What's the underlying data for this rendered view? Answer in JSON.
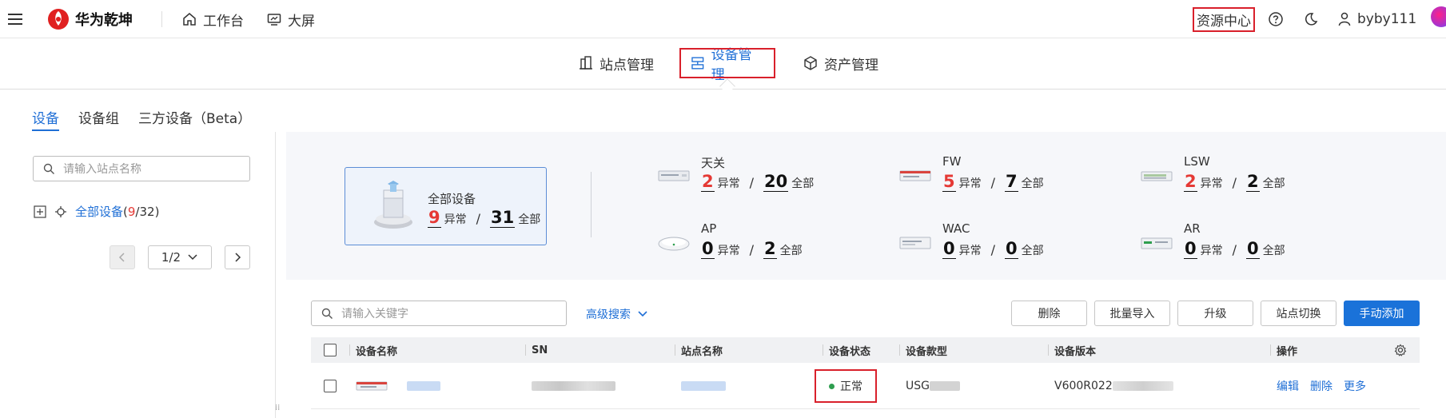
{
  "topbar": {
    "logo_text": "华为乾坤",
    "nav": [
      "工作台",
      "大屏"
    ],
    "resource_center": "资源中心",
    "username": "byby111"
  },
  "secnav": {
    "tabs": [
      "站点管理",
      "设备管理",
      "资产管理"
    ],
    "active": "设备管理"
  },
  "subtabs": [
    "设备",
    "设备组",
    "三方设备（Beta）"
  ],
  "leftpane": {
    "site_search_placeholder": "请输入站点名称",
    "tree_label": "全部设备",
    "tree_abnormal": "9",
    "tree_total": "/32",
    "page": "1/2"
  },
  "stats": {
    "all": {
      "title": "全部设备",
      "abnormal": "9",
      "total": "31"
    },
    "abnormal_label": "异常",
    "total_label": "全部",
    "slash": "/",
    "items": [
      {
        "name": "天关",
        "abnormal": "2",
        "total": "20",
        "icon": "gateway-device-icon"
      },
      {
        "name": "FW",
        "abnormal": "5",
        "total": "7",
        "icon": "firewall-device-icon"
      },
      {
        "name": "LSW",
        "abnormal": "2",
        "total": "2",
        "icon": "switch-device-icon"
      },
      {
        "name": "AP",
        "abnormal": "0",
        "total": "2",
        "icon": "access-point-icon"
      },
      {
        "name": "WAC",
        "abnormal": "0",
        "total": "0",
        "icon": "wac-device-icon"
      },
      {
        "name": "AR",
        "abnormal": "0",
        "total": "0",
        "icon": "router-device-icon"
      }
    ]
  },
  "toolbar": {
    "keyword_placeholder": "请输入关键字",
    "advanced_search": "高级搜索",
    "buttons": [
      "删除",
      "批量导入",
      "升级",
      "站点切换",
      "手动添加"
    ]
  },
  "table": {
    "columns": [
      "设备名称",
      "SN",
      "站点名称",
      "设备状态",
      "设备款型",
      "设备版本",
      "操作"
    ],
    "rows": [
      {
        "status": "正常",
        "model": "USG",
        "version": "V600R022",
        "actions": [
          "编辑",
          "删除",
          "更多"
        ]
      }
    ]
  },
  "colors": {
    "accent": "#1a72d9",
    "abnormal": "#e53935",
    "ok": "#2e9e4f",
    "highlight": "#d9202b"
  }
}
